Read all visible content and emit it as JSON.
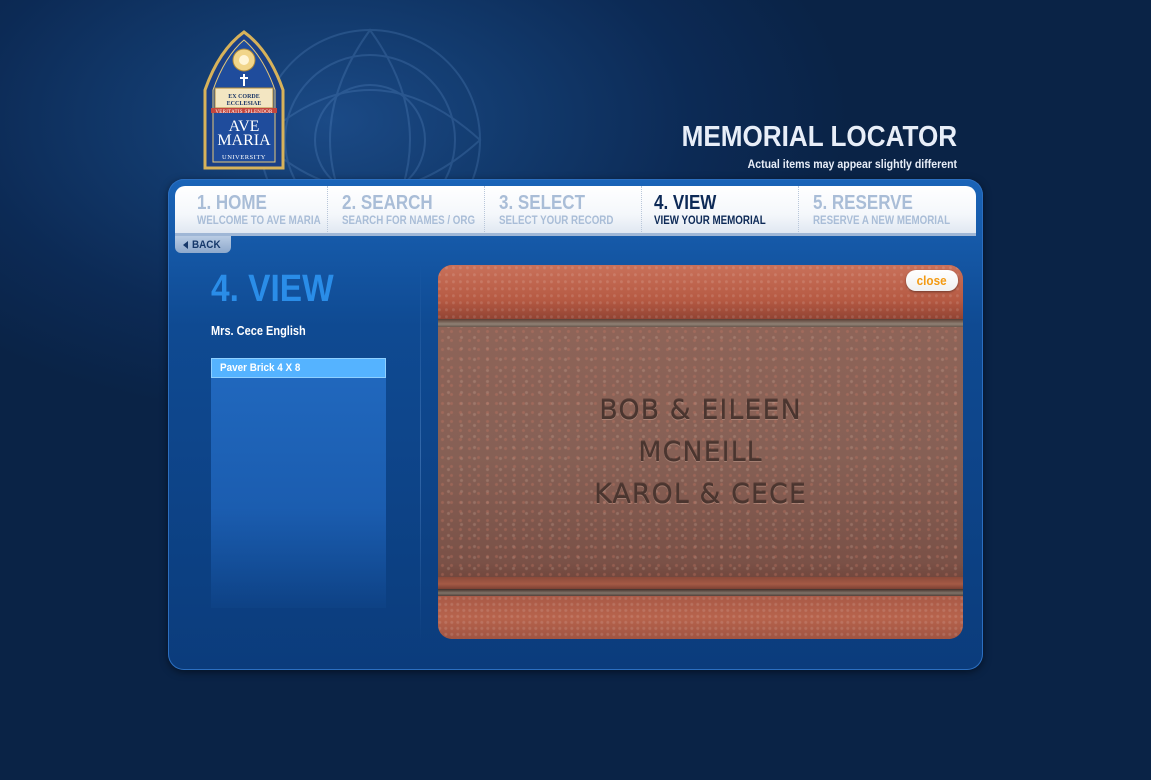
{
  "logo": {
    "motto_line1": "EX CORDE",
    "motto_line2": "ECCLESIAE",
    "motto_banner": "VERITATIS SPLENDOR",
    "name_line1": "AVE",
    "name_line2": "MARIA",
    "name_line3": "UNIVERSITY"
  },
  "header": {
    "title": "MEMORIAL LOCATOR",
    "subtitle": "Actual items may appear slightly different"
  },
  "tabs": [
    {
      "title": "1. HOME",
      "subtitle": "WELCOME TO AVE MARIA",
      "active": false
    },
    {
      "title": "2. SEARCH",
      "subtitle": "SEARCH FOR NAMES / ORG",
      "active": false
    },
    {
      "title": "3. SELECT",
      "subtitle": "SELECT YOUR RECORD",
      "active": false
    },
    {
      "title": "4. VIEW",
      "subtitle": "VIEW YOUR MEMORIAL",
      "active": true
    },
    {
      "title": "5. RESERVE",
      "subtitle": "RESERVE A NEW MEMORIAL",
      "active": false
    }
  ],
  "back_label": "BACK",
  "view": {
    "heading": "4. VIEW",
    "person_name": "Mrs. Cece English",
    "items": [
      "Paver Brick 4 X 8"
    ]
  },
  "memorial": {
    "engraving": [
      "BOB & EILEEN",
      "MCNEILL",
      "KAROL & CECE"
    ],
    "close_label": "close"
  },
  "colors": {
    "background": "#0a2346",
    "panel": "#0f4a92",
    "accent_blue": "#2a8de8",
    "selected_item": "#55b3ff",
    "close_text": "#f39a12"
  }
}
